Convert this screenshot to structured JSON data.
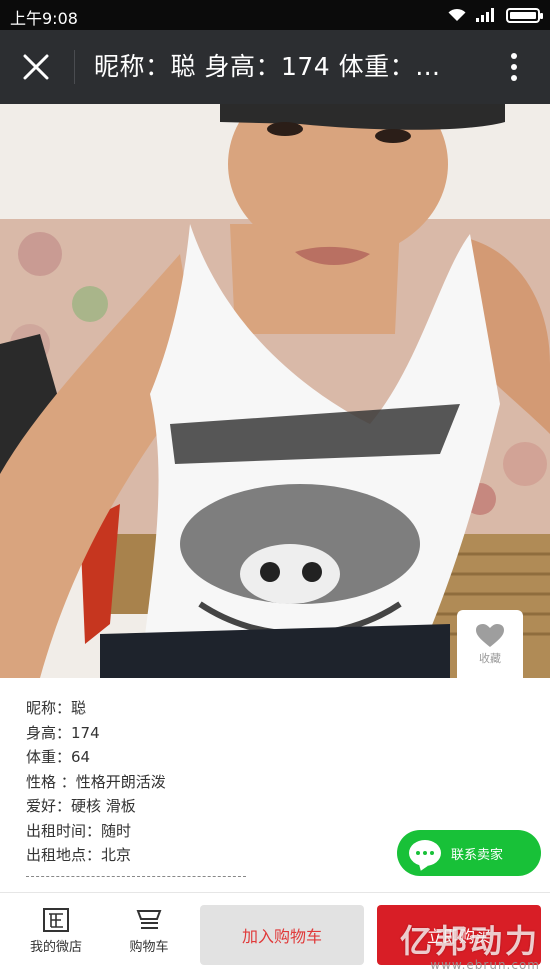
{
  "status_bar": {
    "time": "上午9:08"
  },
  "title_bar": {
    "title": "昵称：聪 身高：174 体重：…"
  },
  "product": {
    "favorite_label": "收藏",
    "info_lines": [
      "昵称：聪",
      "身高：174",
      "体重：64",
      "性格 ：性格开朗活泼",
      "爱好：硬核 滑板",
      "出租时间：随时",
      "出租地点：北京"
    ],
    "divider": "---------------------------------------------"
  },
  "contact_seller": {
    "label": "联系卖家"
  },
  "bottom_bar": {
    "store_label": "我的微店",
    "cart_label": "购物车",
    "add_to_cart_label": "加入购物车",
    "buy_now_label": "立即购买"
  },
  "watermark": {
    "main": "亿邦动力",
    "sub": "www.ebrun.com"
  },
  "colors": {
    "title_bar": "#2c2e31",
    "status_bar": "#0b0b0b",
    "contact_green": "#18c138",
    "buy_red": "#d81e26",
    "add_cart_text": "#e03a3a"
  },
  "icons": {
    "status": [
      "wifi-icon",
      "signal-icon",
      "battery-icon"
    ],
    "title_bar": [
      "close-icon",
      "more-icon"
    ],
    "favorite": "heart-icon",
    "contact": "chat-icon",
    "nav": [
      "store-icon",
      "cart-icon"
    ]
  }
}
